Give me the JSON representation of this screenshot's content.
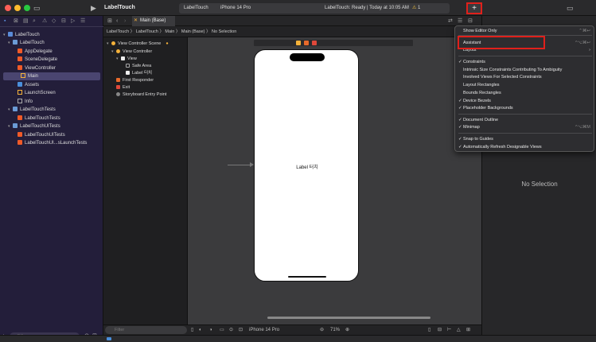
{
  "window": {
    "app_title": "LabelTouch",
    "scheme": "LabelTouch",
    "device": "iPhone 14 Pro",
    "status": "LabelTouch: Ready | Today at 10:05 AM",
    "warning_count": "1",
    "add_label": "+"
  },
  "tabbar": {
    "active_tab": "Main (Base)"
  },
  "jumpbar": {
    "path": "LabelTouch 〉 LabelTouch 〉 Main 〉 Main (Base) 〉 No Selection"
  },
  "navigator": {
    "items": [
      {
        "label": "LabelTouch"
      },
      {
        "label": "LabelTouch"
      },
      {
        "label": "AppDelegate"
      },
      {
        "label": "SceneDelegate"
      },
      {
        "label": "ViewController"
      },
      {
        "label": "Main"
      },
      {
        "label": "Assets"
      },
      {
        "label": "LaunchScreen"
      },
      {
        "label": "Info"
      },
      {
        "label": "LabelTouchTests"
      },
      {
        "label": "LabelTouchTests"
      },
      {
        "label": "LabelTouchUITests"
      },
      {
        "label": "LabelTouchUITests"
      },
      {
        "label": "LabelTouchUI...sLaunchTests"
      }
    ],
    "filter_placeholder": "Filter"
  },
  "outline": {
    "items": [
      {
        "label": "View Controller Scene"
      },
      {
        "label": "View Controller"
      },
      {
        "label": "View"
      },
      {
        "label": "Safe Area"
      },
      {
        "label": "Label 터치"
      },
      {
        "label": "First Responder"
      },
      {
        "label": "Exit"
      },
      {
        "label": "Storyboard Entry Point"
      }
    ],
    "filter_placeholder": "Filter"
  },
  "canvas": {
    "phone_label": "Label 터치",
    "device": "iPhone 14 Pro",
    "zoom": "71%"
  },
  "inspector": {
    "empty_text": "No Selection"
  },
  "menu": {
    "items": [
      {
        "label": "Show Editor Only",
        "checked": false,
        "shortcut": "⌃⌘↩"
      },
      {
        "label": "Assistant",
        "checked": false,
        "shortcut": "^⌥⌘↩"
      },
      {
        "label": "Layout",
        "checked": false,
        "shortcut": "›"
      },
      {
        "label": "Constraints",
        "checked": true,
        "shortcut": ""
      },
      {
        "label": "Intrinsic Size Constraints Contributing To Ambiguity",
        "checked": false,
        "shortcut": ""
      },
      {
        "label": "Involved Views For Selected Constraints",
        "checked": false,
        "shortcut": ""
      },
      {
        "label": "Layout Rectangles",
        "checked": false,
        "shortcut": ""
      },
      {
        "label": "Bounds Rectangles",
        "checked": false,
        "shortcut": ""
      },
      {
        "label": "Device Bezels",
        "checked": true,
        "shortcut": ""
      },
      {
        "label": "Placeholder Backgrounds",
        "checked": true,
        "shortcut": ""
      },
      {
        "label": "Document Outline",
        "checked": true,
        "shortcut": ""
      },
      {
        "label": "Minimap",
        "checked": true,
        "shortcut": "^⌥⌘M"
      },
      {
        "label": "Snap to Guides",
        "checked": true,
        "shortcut": ""
      },
      {
        "label": "Automatically Refresh Designable Views",
        "checked": true,
        "shortcut": ""
      }
    ]
  },
  "colors": {
    "highlight": "#e0201b",
    "navigator_bg": "#231e3a",
    "selection": "#4a4570"
  }
}
